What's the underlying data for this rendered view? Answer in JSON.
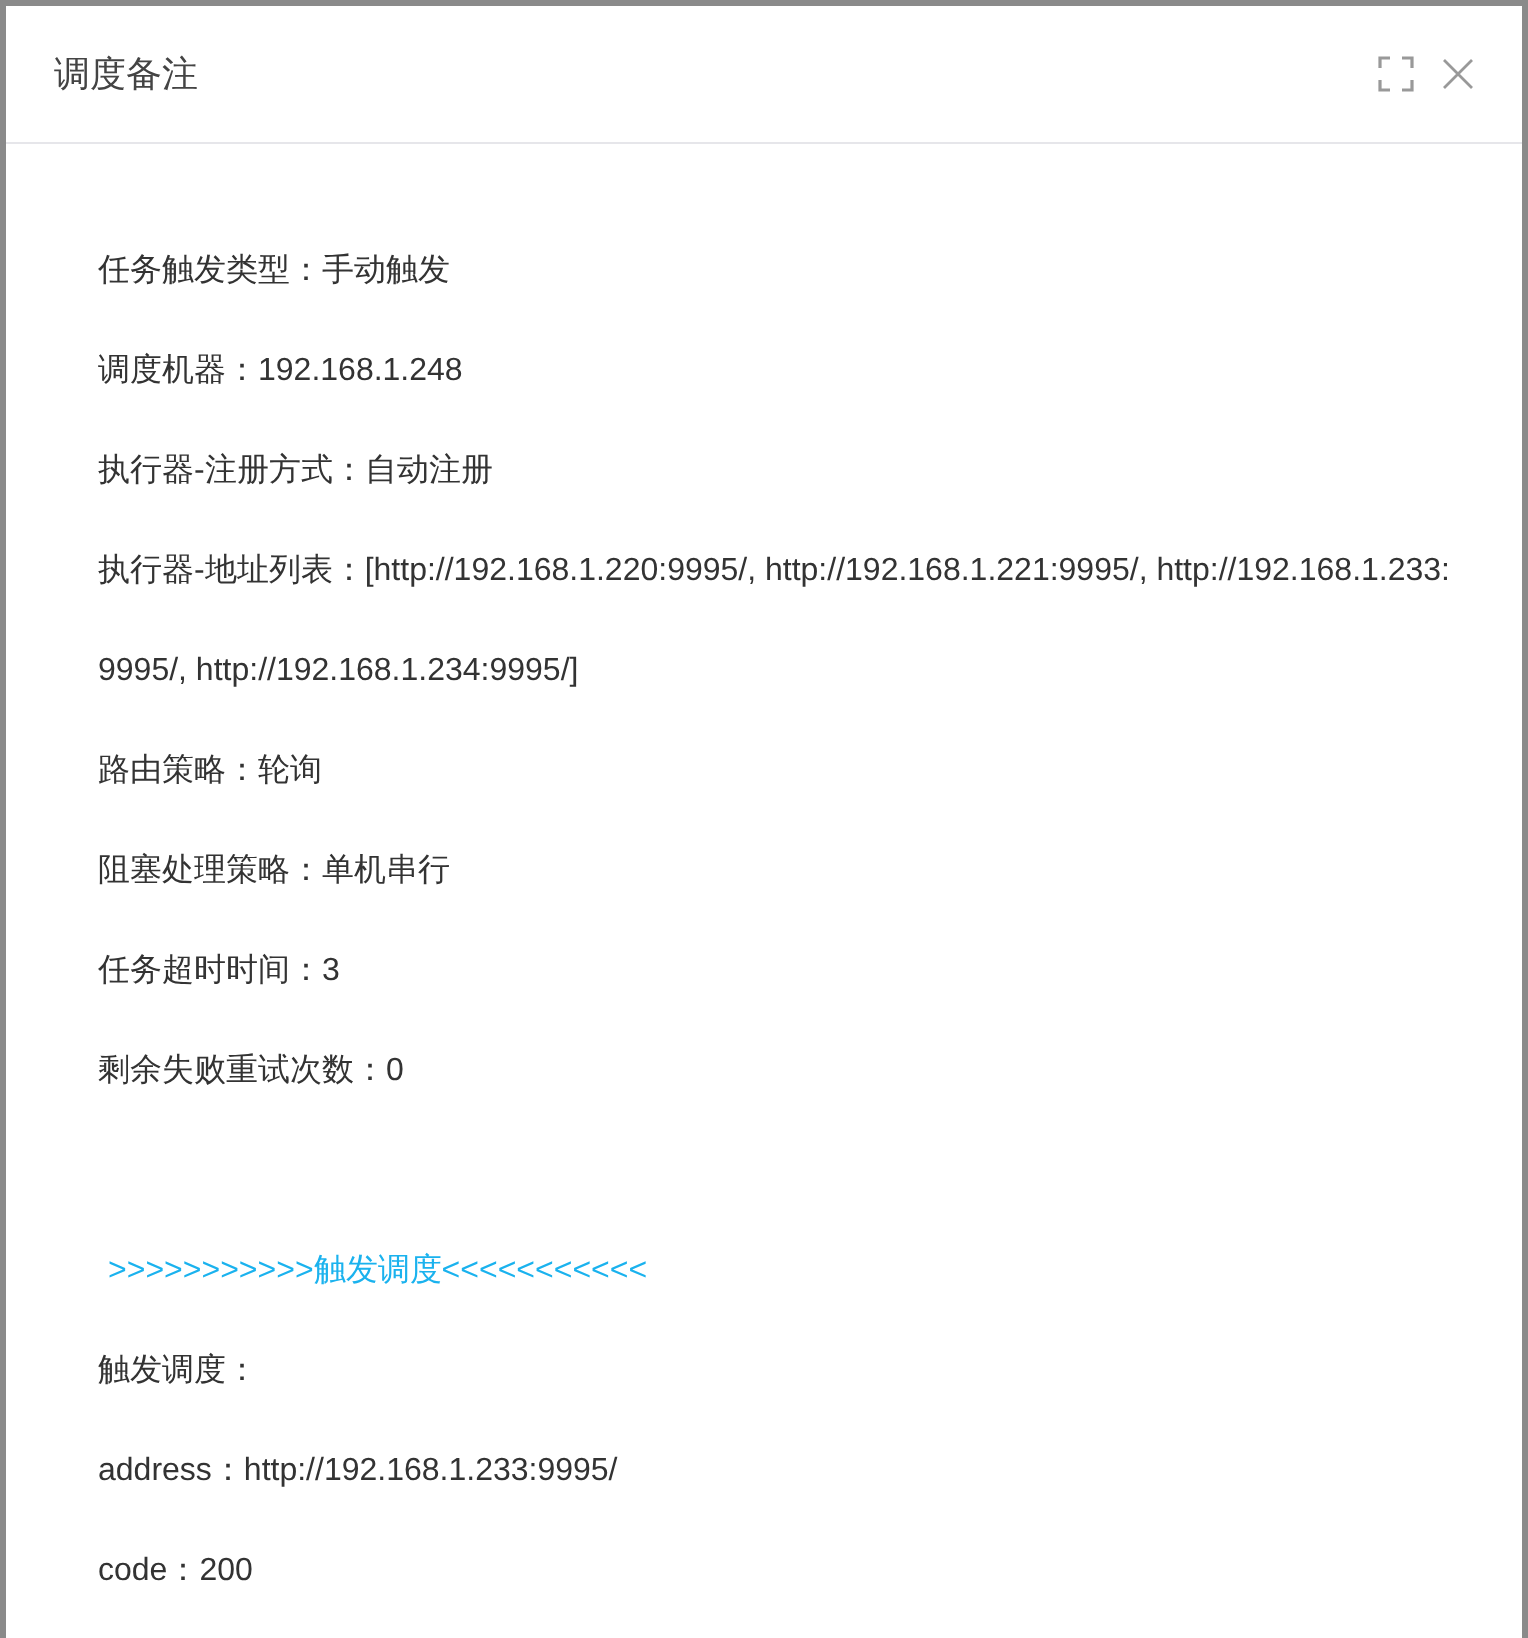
{
  "dialog": {
    "title": "调度备注",
    "lines": [
      {
        "kind": "text",
        "text": "任务触发类型：手动触发"
      },
      {
        "kind": "text",
        "text": "调度机器：192.168.1.248"
      },
      {
        "kind": "text",
        "text": "执行器-注册方式：自动注册"
      },
      {
        "kind": "text",
        "text": "执行器-地址列表：[http://192.168.1.220:9995/, http://192.168.1.221:9995/, http://192.168.1.233:9995/, http://192.168.1.234:9995/]"
      },
      {
        "kind": "text",
        "text": "路由策略：轮询"
      },
      {
        "kind": "text",
        "text": "阻塞处理策略：单机串行"
      },
      {
        "kind": "text",
        "text": "任务超时时间：3"
      },
      {
        "kind": "text",
        "text": "剩余失败重试次数：0"
      },
      {
        "kind": "heading",
        "text": ">>>>>>>>>>>触发调度<<<<<<<<<<<"
      },
      {
        "kind": "text",
        "text": "触发调度："
      },
      {
        "kind": "text",
        "text": "address：http://192.168.1.233:9995/"
      },
      {
        "kind": "text",
        "text": "code：200"
      }
    ]
  }
}
